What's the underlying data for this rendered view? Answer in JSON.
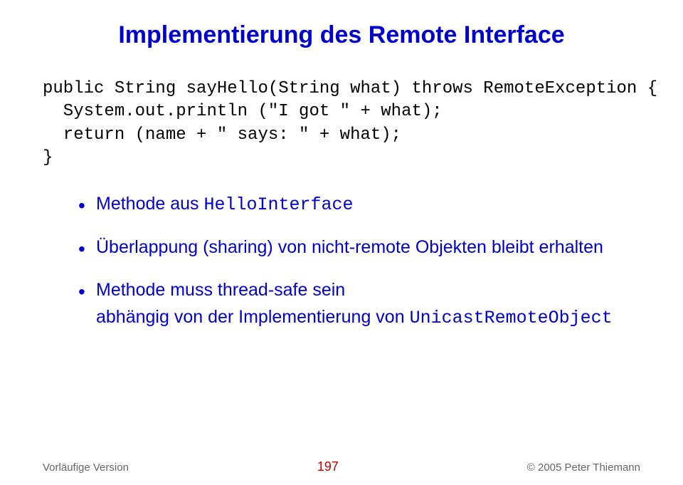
{
  "title": "Implementierung des Remote Interface",
  "code": "public String sayHello(String what) throws RemoteException {\n  System.out.println (\"I got \" + what);\n  return (name + \" says: \" + what);\n}",
  "bullets": [
    {
      "prefix": "Methode aus ",
      "mono": "HelloInterface",
      "suffix": ""
    },
    {
      "prefix": "Überlappung (sharing) von nicht-remote Objekten bleibt erhalten",
      "mono": "",
      "suffix": ""
    },
    {
      "prefix": "Methode muss thread-safe sein",
      "mono": "",
      "suffix": "",
      "sub_prefix": "abhängig von der Implementierung von ",
      "sub_mono": "UnicastRemoteObject"
    }
  ],
  "footer": {
    "left": "Vorläufige Version",
    "center": "197",
    "right": "© 2005 Peter Thiemann"
  }
}
